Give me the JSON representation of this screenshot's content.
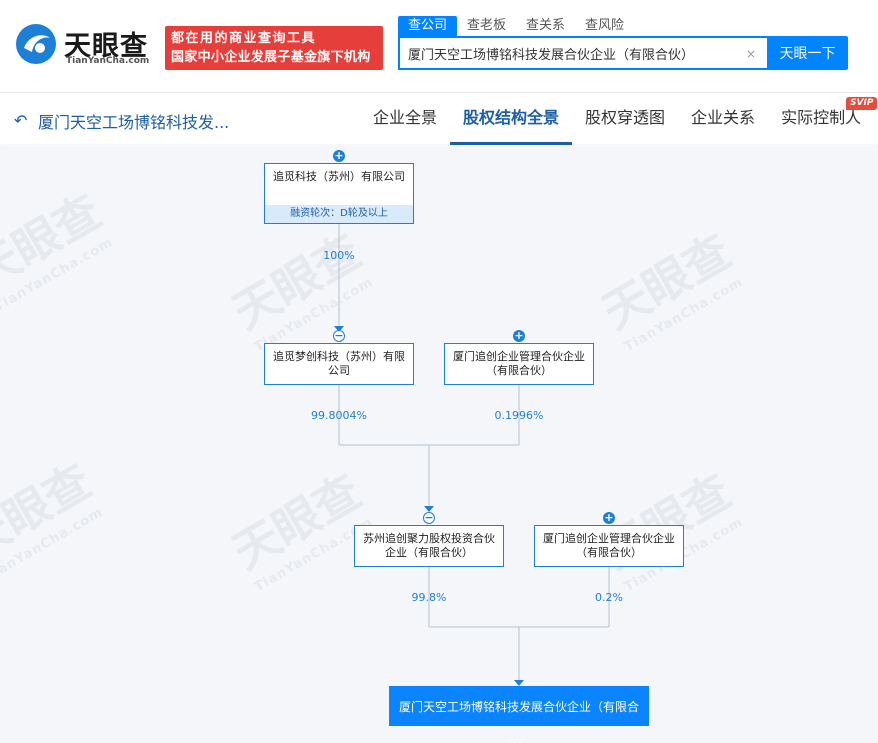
{
  "header": {
    "logo_text": "天眼查",
    "logo_sub": "TianYanCha.com",
    "slogan_line1": "都在用的商业查询工具",
    "slogan_line2": "国家中小企业发展子基金旗下机构",
    "search_tabs": [
      "查公司",
      "查老板",
      "查关系",
      "查风险"
    ],
    "search_value": "厦门天空工场博铭科技发展合伙企业（有限合伙）",
    "search_clear": "×",
    "search_button": "天眼一下"
  },
  "nav": {
    "back_title": "厦门天空工场博铭科技发...",
    "items": [
      "企业全景",
      "股权结构全景",
      "股权穿透图",
      "企业关系",
      "实际控制人"
    ],
    "active_index": 1,
    "svip_badge": "SVIP"
  },
  "chart": {
    "watermark_text": "天眼查",
    "watermark_sub": "TianYanCha.com",
    "nodes": {
      "n1": {
        "name": "追觅科技（苏州）有限公司",
        "meta": "融资轮次：D轮及以上"
      },
      "n2": {
        "name": "追觅梦创科技（苏州）有限公司"
      },
      "n3": {
        "name": "厦门追创企业管理合伙企业（有限合伙）"
      },
      "n4": {
        "name": "苏州追创聚力股权投资合伙企业（有限合伙）"
      },
      "n5": {
        "name": "厦门追创企业管理合伙企业（有限合伙）"
      },
      "target": {
        "name": "厦门天空工场博铭科技发展合伙企业（有限合伙）"
      }
    },
    "percentages": {
      "p1": "100%",
      "p2": "99.8004%",
      "p3": "0.1996%",
      "p4": "99.8%",
      "p5": "0.2%"
    }
  }
}
